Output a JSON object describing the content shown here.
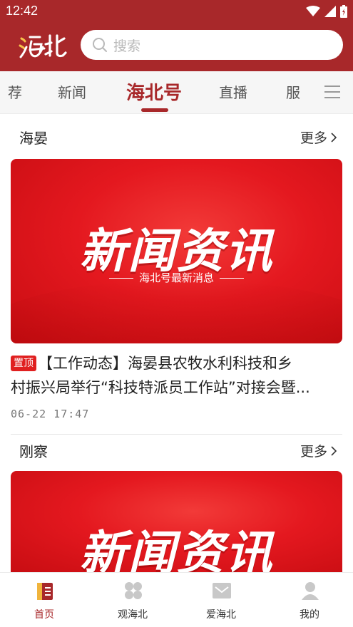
{
  "status_bar": {
    "time": "12:42"
  },
  "header": {
    "logo_text": "海北",
    "search_placeholder": "搜索"
  },
  "tabs": [
    {
      "label": "荐",
      "active": false
    },
    {
      "label": "新闻",
      "active": false
    },
    {
      "label": "海北号",
      "active": true
    },
    {
      "label": "直播",
      "active": false
    },
    {
      "label": "服",
      "active": false
    }
  ],
  "sections": [
    {
      "title": "海晏",
      "more_label": "更多",
      "banner": {
        "headline": "新闻资讯",
        "subtitle": "海北号最新消息"
      },
      "article": {
        "pin_label": "置顶",
        "title_line1": "【工作动态】海晏县农牧水利科技和乡",
        "title_line2": "村振兴局举行“科技特派员工作站”对接会暨...",
        "time": "06-22 17:47"
      }
    },
    {
      "title": "刚察",
      "more_label": "更多",
      "banner": {
        "headline": "新闻资讯"
      }
    }
  ],
  "bottom_nav": [
    {
      "label": "首页",
      "icon": "home-icon",
      "active": true
    },
    {
      "label": "观海北",
      "icon": "watch-icon",
      "active": false
    },
    {
      "label": "爱海北",
      "icon": "love-icon",
      "active": false
    },
    {
      "label": "我的",
      "icon": "profile-icon",
      "active": false
    }
  ],
  "colors": {
    "brand": "#a8282a",
    "banner_red": "#e4181f",
    "pin_red": "#e02020"
  }
}
